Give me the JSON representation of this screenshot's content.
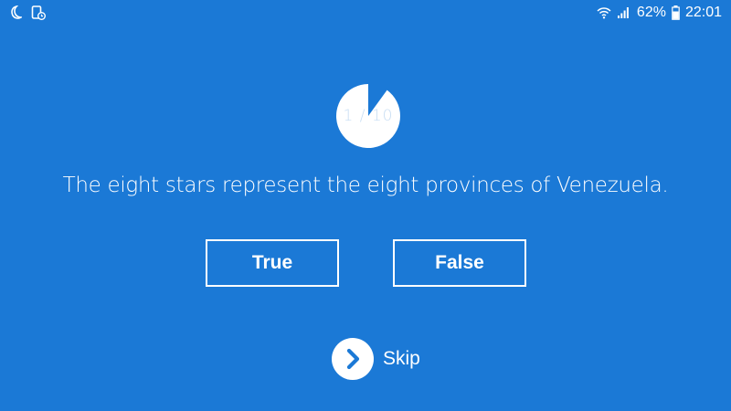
{
  "colors": {
    "background": "#1b79d6",
    "foreground": "#ffffff",
    "progress_text": "#c7ddf3"
  },
  "status_bar": {
    "left_icons": [
      "moon-icon",
      "phone-clock-icon"
    ],
    "right_icons": [
      "wifi-icon",
      "signal-icon",
      "battery-icon"
    ],
    "battery_percent": "62%",
    "time": "22:01"
  },
  "quiz": {
    "progress": {
      "current": 1,
      "total": 10,
      "label": "1 / 10",
      "fraction": 0.1
    },
    "question": "The eight stars represent the eight provinces of Venezuela.",
    "answers": {
      "true_label": "True",
      "false_label": "False"
    },
    "skip": {
      "label": "Skip",
      "icon": "chevron-right-icon"
    }
  }
}
